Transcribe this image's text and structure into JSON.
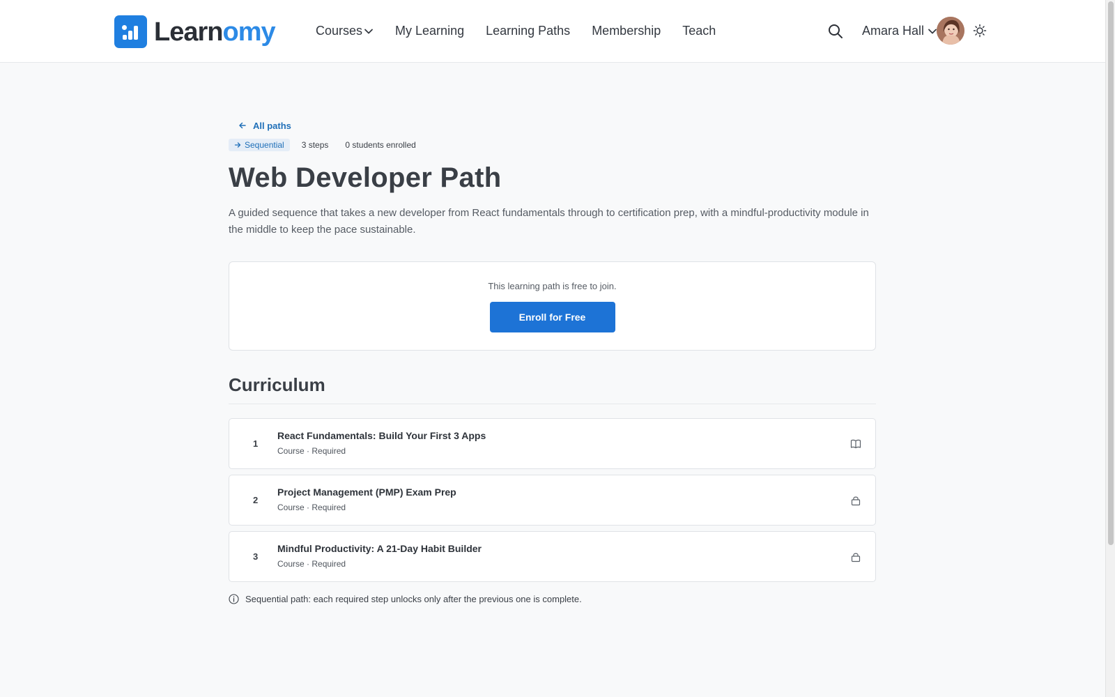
{
  "header": {
    "logo": {
      "part1": "Learn",
      "part2": "omy"
    },
    "nav": [
      {
        "label": "Courses",
        "dropdown": true
      },
      {
        "label": "My Learning"
      },
      {
        "label": "Learning Paths"
      },
      {
        "label": "Membership"
      },
      {
        "label": "Teach"
      }
    ],
    "user_name": "Amara Hall",
    "icons": [
      "search-icon",
      "chevron-down-icon",
      "avatar",
      "sun-icon"
    ]
  },
  "path": {
    "back_label": "All paths",
    "tag": "Sequential",
    "steps_count": "3 steps",
    "enrolled": "0 students enrolled",
    "title": "Web Developer Path",
    "description": "A guided sequence that takes a new developer from React fundamentals through to certification prep, with a mindful-productivity module in the middle to keep the pace sustainable.",
    "enroll_note": "This learning path is free to join.",
    "enroll_button": "Enroll for Free"
  },
  "curriculum": {
    "heading": "Curriculum",
    "steps": [
      {
        "num": "1",
        "title": "React Fundamentals: Build Your First 3 Apps",
        "sub": "Course · Required",
        "icon": "book-icon"
      },
      {
        "num": "2",
        "title": "Project Management (PMP) Exam Prep",
        "sub": "Course · Required",
        "icon": "lock-icon"
      },
      {
        "num": "3",
        "title": "Mindful Productivity: A 21-Day Habit Builder",
        "sub": "Course · Required",
        "icon": "lock-icon"
      }
    ],
    "footnote": "Sequential path: each required step unlocks only after the previous one is complete."
  },
  "colors": {
    "accent": "#1d73d6",
    "logo_blue": "#2c8ae6",
    "text": "#3a3f46"
  }
}
